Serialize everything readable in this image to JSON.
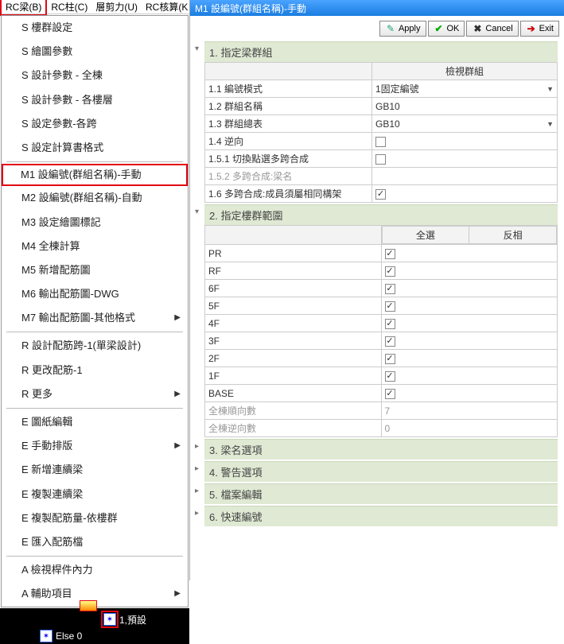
{
  "menubar": {
    "items": [
      {
        "label": "RC梁(B)",
        "highlight": true
      },
      {
        "label": "RC柱(C)"
      },
      {
        "label": "層剪力(U)"
      },
      {
        "label": "RC核算(K"
      }
    ]
  },
  "submenu": {
    "groups": [
      [
        {
          "label": "S 樓群設定"
        },
        {
          "label": "S 繪圖參數"
        },
        {
          "label": "S 設計參數 - 全棟"
        },
        {
          "label": "S 設計參數 - 各樓層"
        },
        {
          "label": "S 設定參數-各跨"
        },
        {
          "label": "S 設定計算書格式"
        }
      ],
      [
        {
          "label": "M1 設編號(群組名稱)-手動",
          "highlight": true
        },
        {
          "label": "M2 設編號(群組名稱)-自動"
        },
        {
          "label": "M3 設定繪圖標記"
        },
        {
          "label": "M4 全棟計算"
        },
        {
          "label": "M5 新增配筋圖"
        },
        {
          "label": "M6 輸出配筋圖-DWG"
        },
        {
          "label": "M7 輸出配筋圖-其他格式",
          "chevron": true
        }
      ],
      [
        {
          "label": "R 設計配筋跨-1(單梁設計)"
        },
        {
          "label": "R 更改配筋-1"
        },
        {
          "label": "R 更多",
          "chevron": true
        }
      ],
      [
        {
          "label": "E 圖紙編輯"
        },
        {
          "label": "E 手動排版",
          "chevron": true
        },
        {
          "label": "E 新增連續梁"
        },
        {
          "label": "E 複製連續梁"
        },
        {
          "label": "E 複製配筋量-依樓群"
        },
        {
          "label": "E 匯入配筋檔"
        }
      ],
      [
        {
          "label": "A 檢視桿件內力"
        },
        {
          "label": "A 輔助項目",
          "chevron": true
        }
      ]
    ]
  },
  "tree": {
    "node1": "1,預設",
    "node0": "Else 0"
  },
  "titlebar": "M1 設編號(群組名稱)-手動",
  "toolbar": {
    "apply": "Apply",
    "ok": "OK",
    "cancel": "Cancel",
    "exit": "Exit"
  },
  "sections": {
    "s1": {
      "title": "1. 指定梁群組",
      "header_col": "檢視群組",
      "rows": [
        {
          "k": "1.1 編號模式",
          "v": "1固定編號",
          "type": "select"
        },
        {
          "k": "1.2 群組名稱",
          "v": "GB10"
        },
        {
          "k": "1.3 群組總表",
          "v": "GB10",
          "type": "select"
        },
        {
          "k": "1.4 逆向",
          "v": "",
          "type": "check",
          "checked": false
        },
        {
          "k": "1.5.1 切換點選多跨合成",
          "v": "",
          "type": "check",
          "checked": false
        },
        {
          "k": "1.5.2 多跨合成:梁名",
          "v": "",
          "disabled": true
        },
        {
          "k": "1.6 多跨合成:成員須屬相同構架",
          "v": "",
          "type": "check",
          "checked": true
        }
      ]
    },
    "s2": {
      "title": "2. 指定樓群範圍",
      "btn_all": "全選",
      "btn_inv": "反相",
      "rows": [
        {
          "k": "PR",
          "checked": true
        },
        {
          "k": "RF",
          "checked": true
        },
        {
          "k": "6F",
          "checked": true
        },
        {
          "k": "5F",
          "checked": true
        },
        {
          "k": "4F",
          "checked": true
        },
        {
          "k": "3F",
          "checked": true
        },
        {
          "k": "2F",
          "checked": true
        },
        {
          "k": "1F",
          "checked": true
        },
        {
          "k": "BASE",
          "checked": true
        },
        {
          "k": "全棟順向數",
          "v": "7",
          "disabled": true
        },
        {
          "k": "全棟逆向數",
          "v": "0",
          "disabled": true
        }
      ]
    },
    "s3": "3. 梁名選項",
    "s4": "4. 警告選項",
    "s5": "5. 檔案編輯",
    "s6": "6. 快速編號"
  }
}
